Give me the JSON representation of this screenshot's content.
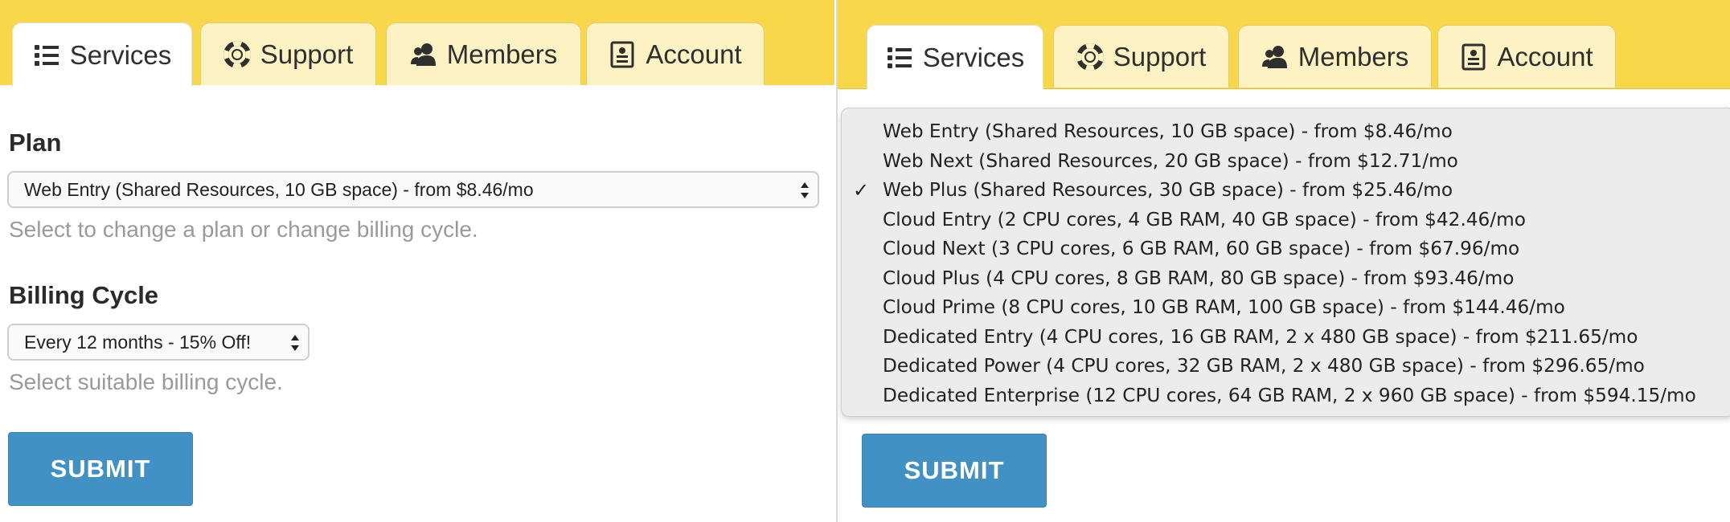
{
  "tabs": [
    {
      "label": "Services",
      "icon": "list-icon"
    },
    {
      "label": "Support",
      "icon": "lifebuoy-icon"
    },
    {
      "label": "Members",
      "icon": "members-icon"
    },
    {
      "label": "Account",
      "icon": "account-card-icon"
    }
  ],
  "form": {
    "plan_label": "Plan",
    "plan_selected": "Web Entry (Shared Resources, 10 GB space) - from $8.46/mo",
    "plan_help": "Select to change a plan or change billing cycle.",
    "billing_label": "Billing Cycle",
    "billing_selected": "Every 12 months - 15% Off!",
    "billing_help": "Select suitable billing cycle.",
    "submit_label": "SUBMIT"
  },
  "plan_options": [
    {
      "label": "Web Entry (Shared Resources, 10 GB space) - from $8.46/mo",
      "checked": false
    },
    {
      "label": "Web Next (Shared Resources, 20 GB space) - from $12.71/mo",
      "checked": false
    },
    {
      "label": "Web Plus (Shared Resources, 30 GB space) - from $25.46/mo",
      "checked": true
    },
    {
      "label": "Cloud Entry (2 CPU cores, 4 GB RAM, 40 GB space) - from $42.46/mo",
      "checked": false
    },
    {
      "label": "Cloud Next (3 CPU cores, 6 GB RAM, 60 GB space) - from $67.96/mo",
      "checked": false
    },
    {
      "label": "Cloud Plus (4 CPU cores, 8 GB RAM, 80 GB space) - from $93.46/mo",
      "checked": false
    },
    {
      "label": "Cloud Prime (8 CPU cores, 10 GB RAM, 100 GB space) - from $144.46/mo",
      "checked": false
    },
    {
      "label": "Dedicated Entry (4 CPU cores, 16 GB RAM, 2 x 480 GB space) - from $211.65/mo",
      "checked": false
    },
    {
      "label": "Dedicated Power (4 CPU cores, 32 GB RAM, 2 x 480 GB space) - from $296.65/mo",
      "checked": false
    },
    {
      "label": "Dedicated Enterprise (12 CPU cores, 64 GB RAM, 2 x 960 GB space) - from $594.15/mo",
      "checked": false
    }
  ],
  "check_glyph": "✓",
  "colors": {
    "tabbar": "#f8d84a",
    "submit": "#4291c4",
    "help_text": "#9a9a9a"
  }
}
